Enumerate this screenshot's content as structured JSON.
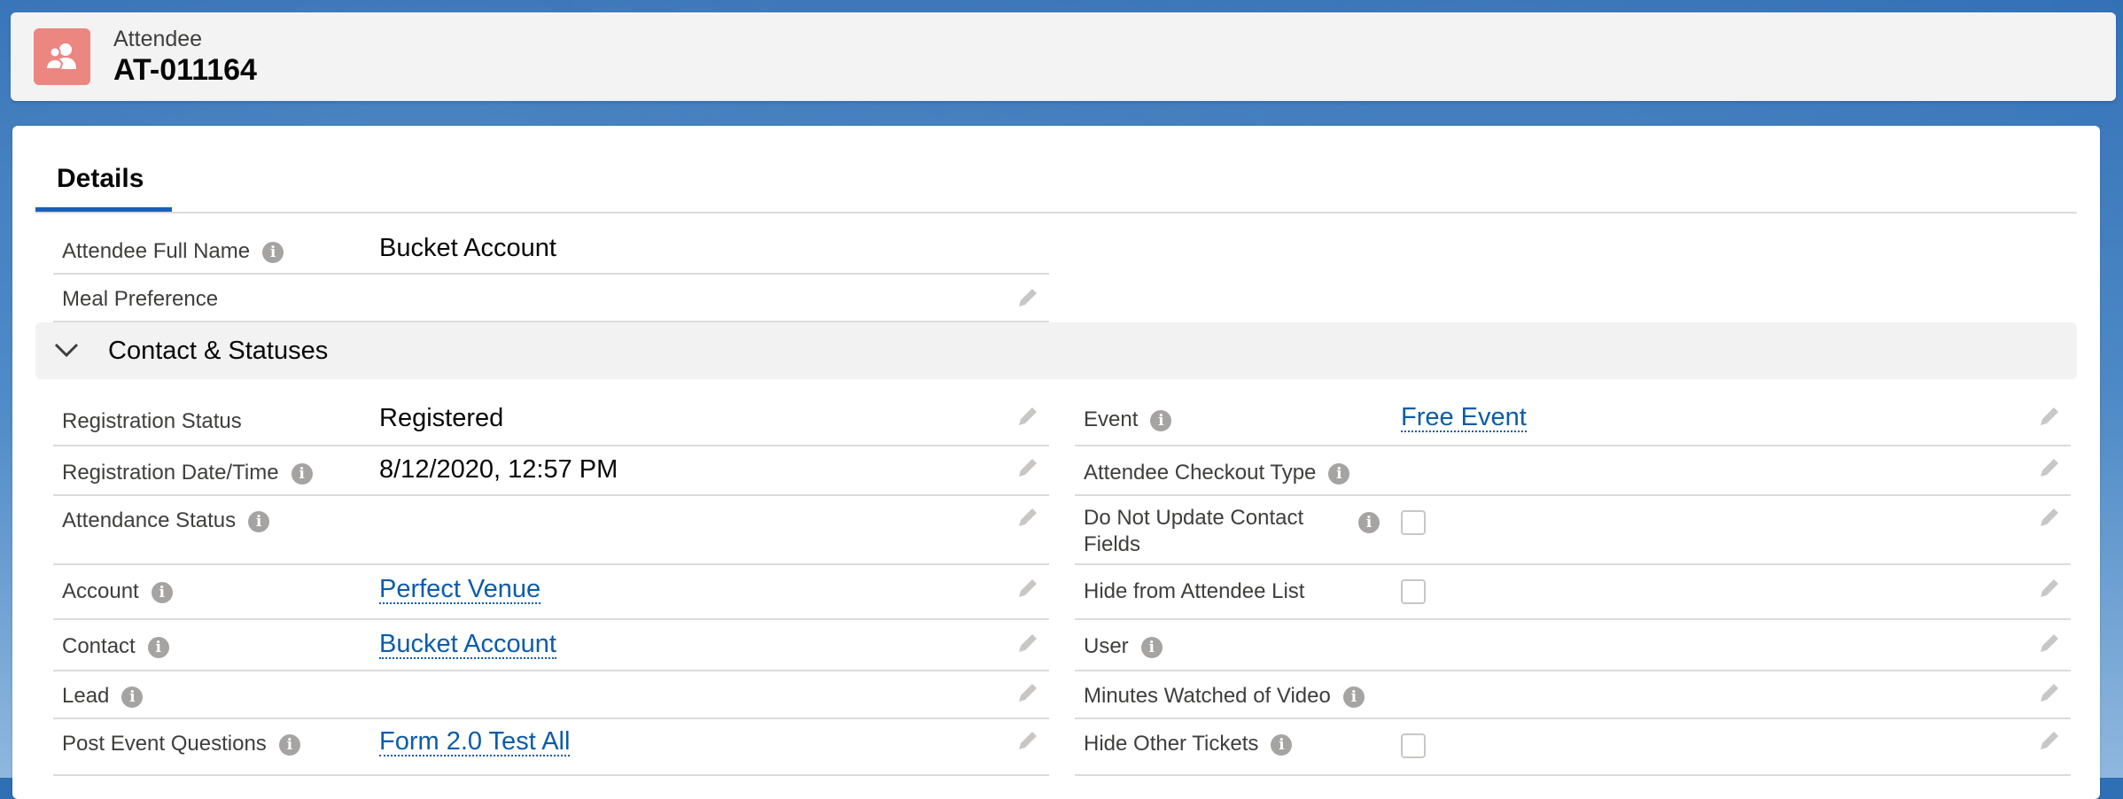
{
  "header": {
    "object_type": "Attendee",
    "record_name": "AT-011164",
    "icon": "people-icon",
    "icon_color": "#ec8680"
  },
  "tabs": [
    {
      "label": "Details",
      "active": true
    }
  ],
  "top_fields": [
    {
      "label": "Attendee Full Name",
      "info": true,
      "value": "Bucket Account",
      "editable": false
    },
    {
      "label": "Meal Preference",
      "info": false,
      "value": "",
      "editable": true
    }
  ],
  "section": {
    "title": "Contact & Statuses",
    "expanded": true
  },
  "left_fields": [
    {
      "label": "Registration Status",
      "info": false,
      "value": "Registered",
      "link": false
    },
    {
      "label": "Registration Date/Time",
      "info": true,
      "value": "8/12/2020, 12:57 PM",
      "link": false
    },
    {
      "label": "Attendance Status",
      "info": true,
      "value": "",
      "link": false
    },
    {
      "label": "Account",
      "info": true,
      "value": "Perfect Venue",
      "link": true
    },
    {
      "label": "Contact",
      "info": true,
      "value": "Bucket Account",
      "link": true
    },
    {
      "label": "Lead",
      "info": true,
      "value": "",
      "link": false
    },
    {
      "label": "Post Event Questions",
      "info": true,
      "value": "Form 2.0 Test All",
      "link": true
    }
  ],
  "right_fields": [
    {
      "label": "Event",
      "info": true,
      "value": "Free Event",
      "link": true
    },
    {
      "label": "Attendee Checkout Type",
      "info": true,
      "value": ""
    },
    {
      "label": "Do Not Update Contact Fields",
      "info": true,
      "checkbox": true,
      "checked": false
    },
    {
      "label": "Hide from Attendee List",
      "info": false,
      "checkbox": true,
      "checked": false
    },
    {
      "label": "User",
      "info": true,
      "value": ""
    },
    {
      "label": "Minutes Watched of Video",
      "info": true,
      "value": ""
    },
    {
      "label": "Hide Other Tickets",
      "info": true,
      "checkbox": true,
      "checked": false
    }
  ],
  "colors": {
    "link": "#0b5cab",
    "tab_active": "#1b5fb5"
  }
}
